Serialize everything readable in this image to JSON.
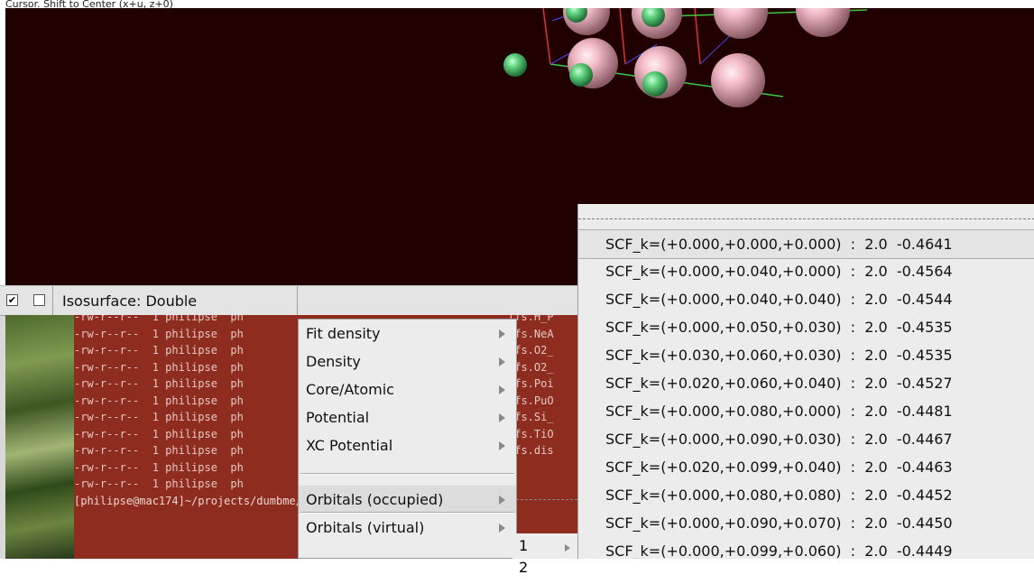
{
  "status_text": "Cursor. Shift to Center (x+u, z+0)",
  "isosurface": {
    "checkbox_checked_glyph": "✔",
    "checkbox1_checked": true,
    "checkbox2_checked": false,
    "label": "Isosurface: Double"
  },
  "terminal": {
    "lines": [
      {
        "perm": "-rw-r--r--",
        "links": "1",
        "user": "philipse",
        "group": "ph",
        "file": "ffs.H_P"
      },
      {
        "perm": "-rw-r--r--",
        "links": "1",
        "user": "philipse",
        "group": "ph",
        "file": "ffs.NeA"
      },
      {
        "perm": "-rw-r--r--",
        "links": "1",
        "user": "philipse",
        "group": "ph",
        "file": "ffs.O2_"
      },
      {
        "perm": "-rw-r--r--",
        "links": "1",
        "user": "philipse",
        "group": "ph",
        "file": "ffs.O2_"
      },
      {
        "perm": "-rw-r--r--",
        "links": "1",
        "user": "philipse",
        "group": "ph",
        "file": "ffs.Poi"
      },
      {
        "perm": "-rw-r--r--",
        "links": "1",
        "user": "philipse",
        "group": "ph",
        "file": "ffs.PuO"
      },
      {
        "perm": "-rw-r--r--",
        "links": "1",
        "user": "philipse",
        "group": "ph",
        "file": "ffs.Si_"
      },
      {
        "perm": "-rw-r--r--",
        "links": "1",
        "user": "philipse",
        "group": "ph",
        "file": "ffs.TiO"
      },
      {
        "perm": "-rw-r--r--",
        "links": "1",
        "user": "philipse",
        "group": "ph",
        "file": "ffs.dis"
      },
      {
        "perm": "-rw-r--r--",
        "links": "1",
        "user": "philipse",
        "group": "ph",
        "file": ""
      },
      {
        "perm": "-rw-r--r--",
        "links": "1",
        "user": "philipse",
        "group": "ph",
        "file": ""
      }
    ],
    "prompt": "[philipse@mac174]~/projects/dumbme/test.TestBundl%"
  },
  "context_menu": {
    "items": [
      {
        "label": "Fit density",
        "submenu": true
      },
      {
        "label": "Density",
        "submenu": true
      },
      {
        "label": "Core/Atomic",
        "submenu": true
      },
      {
        "label": "Potential",
        "submenu": true
      },
      {
        "label": "XC Potential",
        "submenu": true
      },
      {
        "label": "Orbitals (occupied)",
        "submenu": true
      },
      {
        "label": "Orbitals (virtual)",
        "submenu": true
      }
    ]
  },
  "submenu_numbers": {
    "item1": "1",
    "item2": "2"
  },
  "orbitals": [
    {
      "label": "SCF_k=(+0.000,+0.000,+0.000)  :  2.0  -0.4641"
    },
    {
      "label": "SCF_k=(+0.000,+0.040,+0.000)  :  2.0  -0.4564"
    },
    {
      "label": "SCF_k=(+0.000,+0.040,+0.040)  :  2.0  -0.4544"
    },
    {
      "label": "SCF_k=(+0.000,+0.050,+0.030)  :  2.0  -0.4535"
    },
    {
      "label": "SCF_k=(+0.030,+0.060,+0.030)  :  2.0  -0.4535"
    },
    {
      "label": "SCF_k=(+0.020,+0.060,+0.040)  :  2.0  -0.4527"
    },
    {
      "label": "SCF_k=(+0.000,+0.080,+0.000)  :  2.0  -0.4481"
    },
    {
      "label": "SCF_k=(+0.000,+0.090,+0.030)  :  2.0  -0.4467"
    },
    {
      "label": "SCF_k=(+0.020,+0.099,+0.040)  :  2.0  -0.4463"
    },
    {
      "label": "SCF_k=(+0.000,+0.080,+0.080)  :  2.0  -0.4452"
    },
    {
      "label": "SCF_k=(+0.000,+0.090,+0.070)  :  2.0  -0.4450"
    },
    {
      "label": "SCF_k=(+0.000,+0.099,+0.060)  :  2.0  -0.4449"
    }
  ],
  "colors": {
    "viewport_bg": "#210000",
    "atom_pink": "#f0b4c0",
    "atom_green": "#5fc77a",
    "bond_red": "#e03030",
    "bond_green": "#40c840",
    "bond_blue": "#4040d8",
    "terminal_bg": "#8e2c20"
  }
}
